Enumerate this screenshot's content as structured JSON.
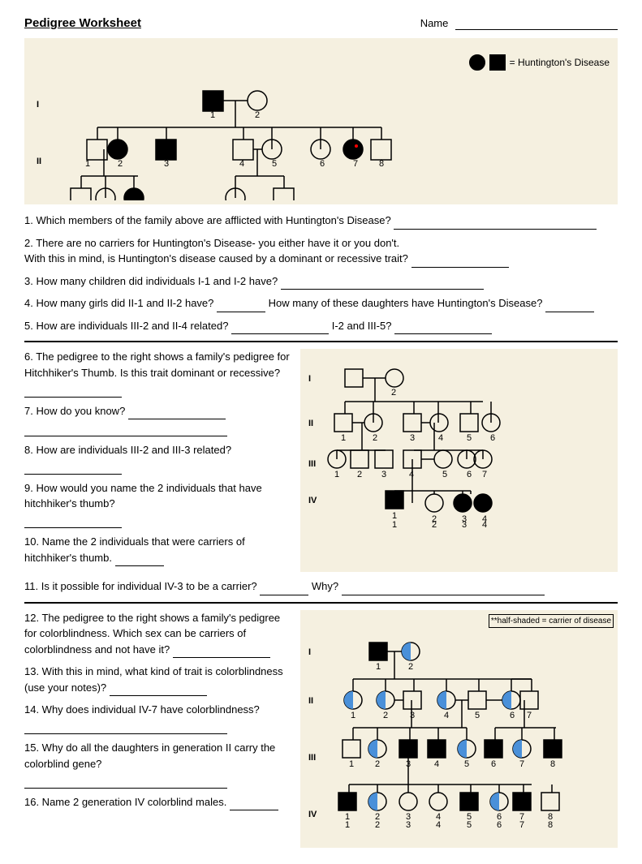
{
  "header": {
    "title": "Pedigree Worksheet",
    "name_label": "Name",
    "name_line": ""
  },
  "legend": {
    "equals": "= Huntington's Disease"
  },
  "questions": {
    "q1": "1. Which members of the family above are afflicted with Huntington's Disease?",
    "q2a": "2. There are no carriers for Huntington's Disease- you either have it or you don't.",
    "q2b": "     With this in mind, is Huntington's disease caused by a dominant or recessive trait?",
    "q3": "3. How many children did individuals I-1 and I-2 have?",
    "q4a": "4. How many girls did II-1 and II-2 have?",
    "q4b": "How many of these daughters have Huntington's Disease?",
    "q5a": "5. How are individuals III-2 and II-4 related?",
    "q5b": "I-2 and III-5?",
    "q6": "6. The pedigree to the right shows a family's pedigree for Hitchhiker's Thumb. Is this trait dominant or recessive?",
    "q7": "7. How do you know?",
    "q8": "8. How are individuals III-2 and III-3 related?",
    "q9": "9. How would you name the 2 individuals that have hitchhiker's thumb?",
    "q10": "10. Name the 2 individuals that were carriers of hitchhiker's thumb.",
    "q11": "11. Is it possible for individual IV-3 to be a carrier?",
    "q11b": "Why?",
    "q12": "12. The pedigree to the right shows a family's pedigree for colorblindness.  Which sex can be carriers of colorblindness and not have it?",
    "q13": "13. With this in mind, what kind of trait is colorblindness (use your notes)?",
    "q14": "14. Why does individual IV-7 have colorblindness?",
    "q15": "15. Why do all the daughters in generation II carry the colorblind gene?",
    "q16": "16. Name 2 generation IV colorblind males.",
    "cb_legend": "**half-shaded = carrier of disease"
  },
  "roman_numerals": {
    "I": "I",
    "II": "II",
    "III": "III",
    "IV": "IV"
  }
}
